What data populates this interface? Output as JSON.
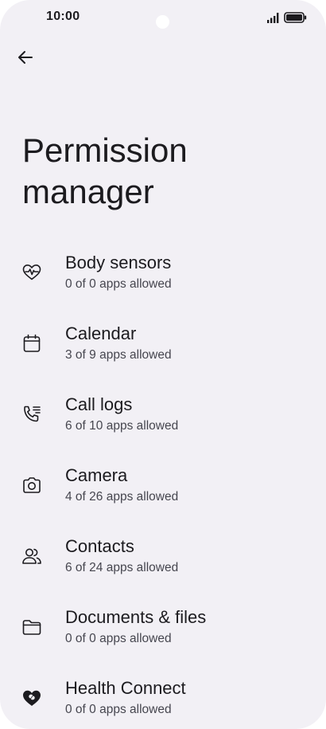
{
  "status_bar": {
    "time": "10:00"
  },
  "header": {
    "back_icon": "arrow-back-icon",
    "title": "Permission manager"
  },
  "permissions": [
    {
      "icon": "heart-pulse-icon",
      "label": "Body sensors",
      "subtitle": "0 of 0 apps allowed"
    },
    {
      "icon": "calendar-icon",
      "label": "Calendar",
      "subtitle": "3 of 9 apps allowed"
    },
    {
      "icon": "phone-log-icon",
      "label": "Call logs",
      "subtitle": "6 of 10 apps allowed"
    },
    {
      "icon": "camera-icon",
      "label": "Camera",
      "subtitle": "4 of 26 apps allowed"
    },
    {
      "icon": "contacts-icon",
      "label": "Contacts",
      "subtitle": "6 of 24 apps allowed"
    },
    {
      "icon": "folder-icon",
      "label": "Documents & files",
      "subtitle": "0 of 0 apps allowed"
    },
    {
      "icon": "health-connect-icon",
      "label": "Health Connect",
      "subtitle": "0 of 0 apps allowed"
    }
  ],
  "colors": {
    "background": "#f2f0f5",
    "text_primary": "#1c1b1f",
    "text_secondary": "#46464f"
  }
}
